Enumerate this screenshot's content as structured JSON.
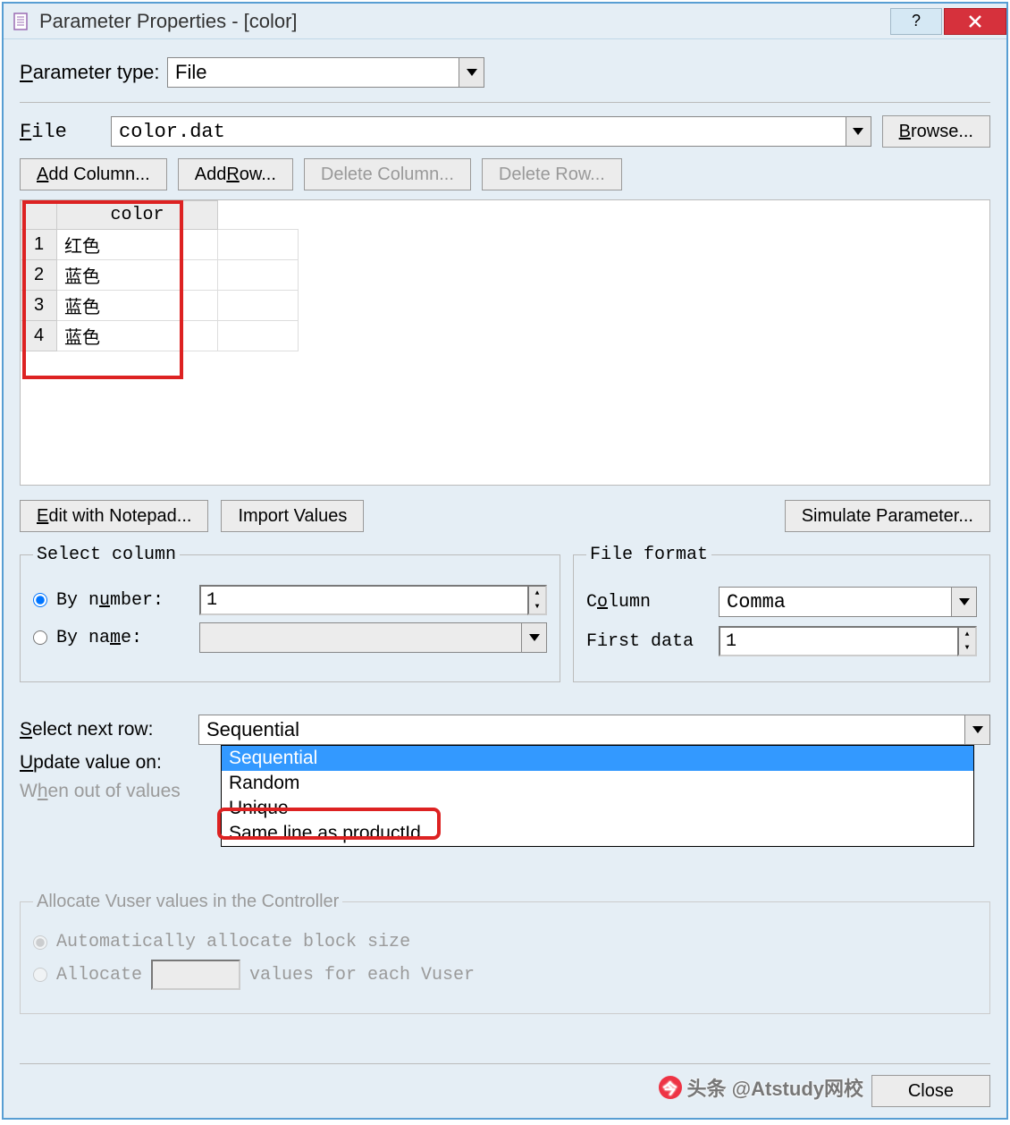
{
  "window": {
    "title": "Parameter Properties - [color]"
  },
  "paramType": {
    "label": "Parameter type:",
    "value": "File"
  },
  "file": {
    "label": "File",
    "value": "color.dat",
    "browse": "Browse..."
  },
  "gridButtons": {
    "addColumn": "Add Column...",
    "addRow": "Add Row...",
    "deleteColumn": "Delete Column...",
    "deleteRow": "Delete Row..."
  },
  "grid": {
    "columnHeader": "color",
    "rows": [
      {
        "n": "1",
        "v": "红色"
      },
      {
        "n": "2",
        "v": "蓝色"
      },
      {
        "n": "3",
        "v": "蓝色"
      },
      {
        "n": "4",
        "v": "蓝色"
      }
    ]
  },
  "midButtons": {
    "editNotepad": "Edit with Notepad...",
    "importValues": "Import Values",
    "simulate": "Simulate Parameter..."
  },
  "selectColumn": {
    "legend": "Select column",
    "byNumberLabel": "By number:",
    "byNumberValue": "1",
    "byNameLabel": "By name:",
    "byNameValue": ""
  },
  "fileFormat": {
    "legend": "File format",
    "columnLabel": "Column",
    "columnValue": "Comma",
    "firstDataLabel": "First data",
    "firstDataValue": "1"
  },
  "nextRow": {
    "label": "Select next row:",
    "value": "Sequential",
    "options": [
      "Sequential",
      "Random",
      "Unique",
      "Same line as productId"
    ]
  },
  "updateValue": {
    "label": "Update value on:"
  },
  "whenOut": {
    "label": "When out of values"
  },
  "allocate": {
    "legend": "Allocate Vuser values in the Controller",
    "auto": "Automatically allocate block size",
    "alloc": "Allocate",
    "suffix": "values for each Vuser"
  },
  "footer": {
    "close": "Close"
  },
  "watermark": "头条 @Atstudy网校"
}
